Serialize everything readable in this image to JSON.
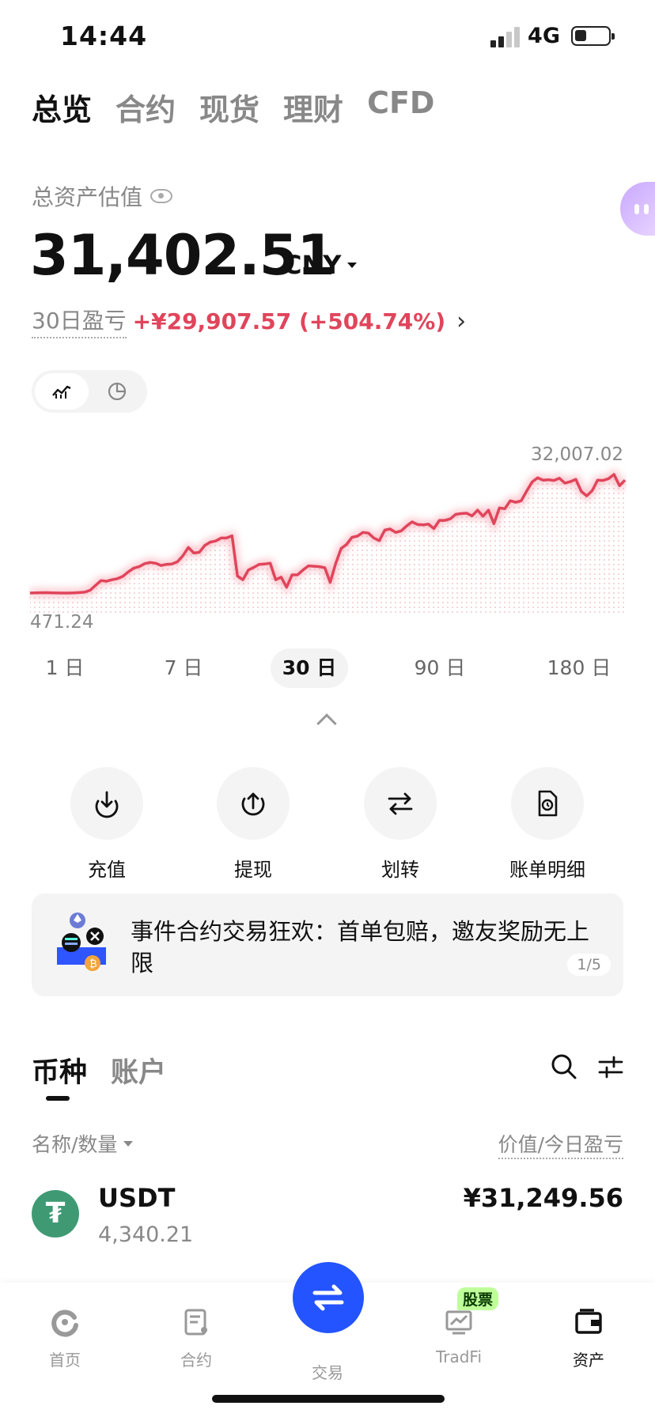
{
  "status_bar": {
    "time": "14:44",
    "network": "4G"
  },
  "top_tabs": [
    {
      "label": "总览",
      "active": true
    },
    {
      "label": "合约",
      "active": false
    },
    {
      "label": "现货",
      "active": false
    },
    {
      "label": "理财",
      "active": false
    },
    {
      "label": "CFD",
      "active": false
    }
  ],
  "overview": {
    "asset_label": "总资产估值",
    "total_value": "31,402.51",
    "currency": "CNY",
    "pnl_label": "30日盈亏",
    "pnl_value": "+¥29,907.57 (+504.74%)"
  },
  "chart_data": {
    "type": "area",
    "max_label": "32,007.02",
    "min_label": "471.24",
    "color": "#e0455b",
    "values": [
      471,
      520,
      560,
      580,
      530,
      500,
      480,
      470,
      520,
      600,
      700,
      1200,
      2500,
      3800,
      3600,
      4000,
      4300,
      4900,
      6100,
      7100,
      7500,
      8300,
      8600,
      8400,
      7800,
      8100,
      8200,
      8800,
      10400,
      12600,
      11100,
      11300,
      13100,
      14000,
      14300,
      15100,
      15100,
      15700,
      5000,
      4000,
      6600,
      7300,
      8100,
      8200,
      8400,
      4000,
      4700,
      2000,
      5300,
      5300,
      6600,
      7700,
      7600,
      7500,
      7200,
      3300,
      8300,
      12300,
      13400,
      15300,
      15600,
      16600,
      16400,
      15100,
      14400,
      17200,
      17500,
      16600,
      17000,
      18300,
      19400,
      18700,
      18600,
      18800,
      17600,
      19800,
      19800,
      20200,
      21400,
      21600,
      21700,
      21000,
      22500,
      20900,
      22500,
      18900,
      23100,
      22900,
      25000,
      24600,
      25000,
      27600,
      30000,
      31100,
      30500,
      30600,
      30400,
      31000,
      29700,
      30100,
      30700,
      27500,
      26300,
      27700,
      30500,
      30400,
      30900,
      32007,
      29000,
      30500
    ],
    "ranges": [
      {
        "label": "1 日",
        "active": false
      },
      {
        "label": "7 日",
        "active": false
      },
      {
        "label": "30 日",
        "active": true
      },
      {
        "label": "90 日",
        "active": false
      },
      {
        "label": "180 日",
        "active": false
      }
    ]
  },
  "actions": [
    {
      "label": "充值",
      "icon": "deposit-icon"
    },
    {
      "label": "提现",
      "icon": "withdraw-icon"
    },
    {
      "label": "划转",
      "icon": "transfer-icon"
    },
    {
      "label": "账单明细",
      "icon": "bill-icon"
    }
  ],
  "banner": {
    "text": "事件合约交易狂欢：首单包赔，邀友奖励无上限",
    "page": "1/5"
  },
  "holdings": {
    "tabs": [
      {
        "label": "币种",
        "active": true
      },
      {
        "label": "账户",
        "active": false
      }
    ],
    "col_left": "名称/数量",
    "col_right": "价值/今日盈亏",
    "rows": [
      {
        "name": "USDT",
        "qty": "4,340.21",
        "value": "¥31,249.56"
      }
    ]
  },
  "bottom_nav": [
    {
      "label": "首页",
      "icon": "home-icon"
    },
    {
      "label": "合约",
      "icon": "contract-icon"
    },
    {
      "label": "交易",
      "icon": "trade-icon"
    },
    {
      "label": "TradFi",
      "icon": "tradfi-icon",
      "badge": "股票"
    },
    {
      "label": "资产",
      "icon": "assets-icon",
      "active": true
    }
  ]
}
